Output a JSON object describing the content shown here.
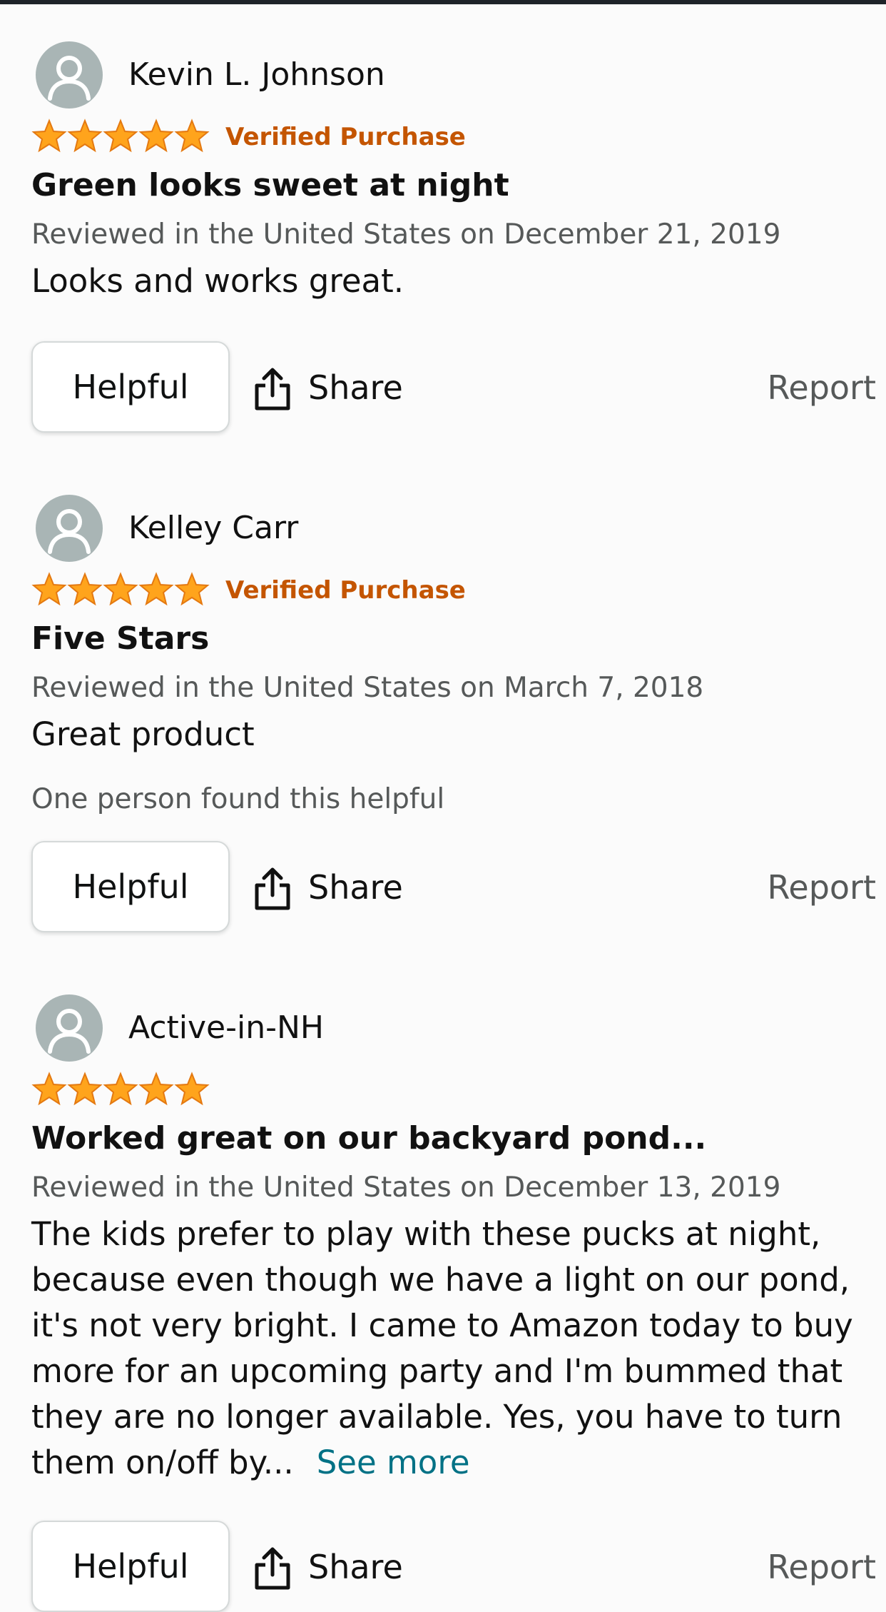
{
  "reviews": [
    {
      "reviewer": "Kevin L. Johnson",
      "rating": 5,
      "verified_label": "Verified Purchase",
      "title": "Green looks sweet at night",
      "date": "Reviewed in the United States on December 21, 2019",
      "body": "Looks and works great.",
      "helpful_count_text": "",
      "helpful_label": "Helpful",
      "share_label": "Share",
      "report_label": "Report"
    },
    {
      "reviewer": "Kelley Carr",
      "rating": 5,
      "verified_label": "Verified Purchase",
      "title": "Five Stars",
      "date": "Reviewed in the United States on March 7, 2018",
      "body": "Great product",
      "helpful_count_text": "One person found this helpful",
      "helpful_label": "Helpful",
      "share_label": "Share",
      "report_label": "Report"
    },
    {
      "reviewer": "Active-in-NH",
      "rating": 5,
      "verified_label": "",
      "title": "Worked great on our backyard pond...",
      "date": "Reviewed in the United States on December 13, 2019",
      "body": "The kids prefer to play with these pucks at night, because even though we have a light on our pond, it's not very bright. I came to Amazon today to buy more for an upcoming party and I'm bummed that they are no longer available. Yes, you have to turn them on/off by...",
      "see_more_label": "See more",
      "helpful_count_text": "",
      "helpful_label": "Helpful",
      "share_label": "Share",
      "report_label": "Report"
    }
  ],
  "colors": {
    "star": "#ffa41c",
    "verified": "#c45500",
    "link": "#007185",
    "muted": "#565959",
    "avatar_bg": "#a9b5b5"
  },
  "icons": {
    "avatar": "person-silhouette-icon",
    "star": "star-icon",
    "share": "share-icon"
  }
}
